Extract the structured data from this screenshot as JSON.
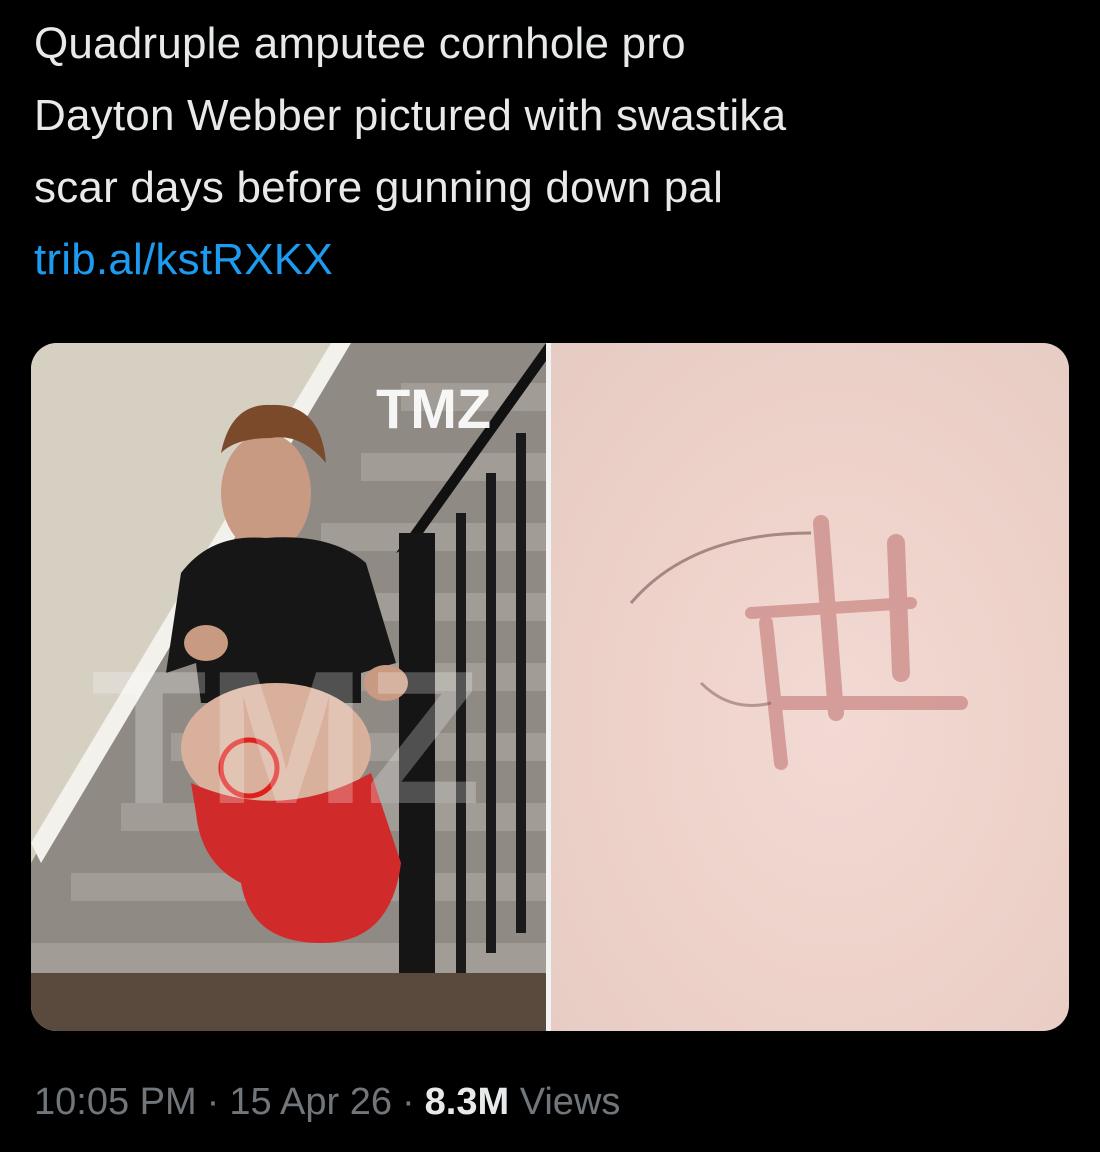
{
  "tweet": {
    "text_lines": [
      "Quadruple amputee cornhole pro",
      "Dayton Webber pictured with swastika",
      "scar days before gunning down pal"
    ],
    "link_text": "trib.al/kstRXKX"
  },
  "media": {
    "watermark": "TMZ"
  },
  "meta": {
    "time": "10:05 PM",
    "separator": "·",
    "date": "15 Apr 26",
    "views_count": "8.3M",
    "views_label": "Views"
  },
  "colors": {
    "background": "#000000",
    "text": "#e7e9ea",
    "link": "#1d9bf0",
    "muted": "#71767b",
    "highlight_circle": "#e0201c"
  }
}
